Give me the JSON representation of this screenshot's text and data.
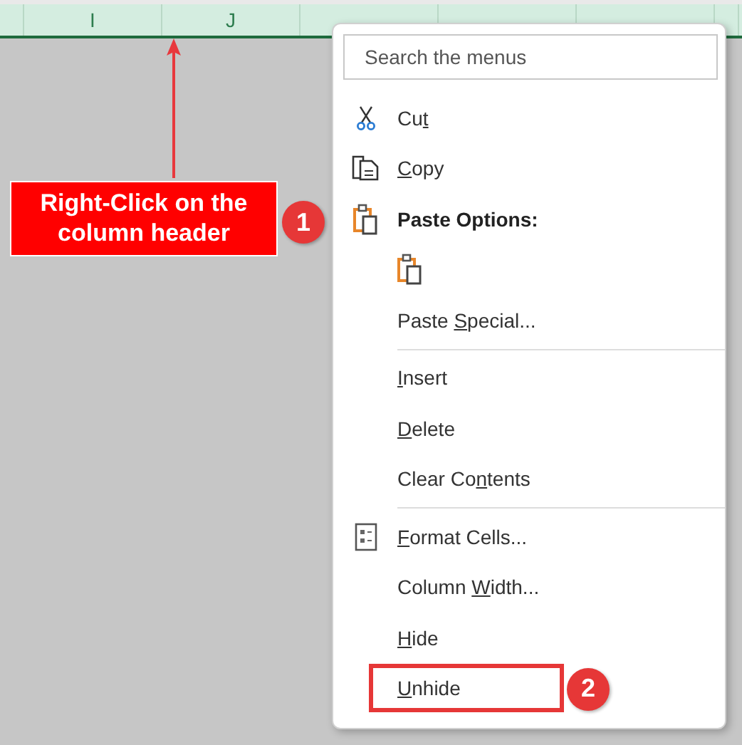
{
  "columns": [
    "I",
    "J"
  ],
  "callout": {
    "text": "Right-Click on the column header",
    "step": "1"
  },
  "menu": {
    "search": {
      "placeholder": "Search the menus"
    },
    "items": [
      {
        "kind": "command",
        "pre": "Cu",
        "key": "t"
      },
      {
        "kind": "command",
        "key": "C",
        "post": "opy"
      },
      {
        "kind": "heading",
        "pre": "Paste Options:"
      },
      {
        "kind": "paste-button"
      },
      {
        "kind": "command",
        "pre": "Paste ",
        "key": "S",
        "post": "pecial..."
      },
      {
        "kind": "divider"
      },
      {
        "kind": "command",
        "key": "I",
        "post": "nsert"
      },
      {
        "kind": "command",
        "key": "D",
        "post": "elete"
      },
      {
        "kind": "command",
        "pre": "Clear Co",
        "key": "n",
        "post": "tents"
      },
      {
        "kind": "divider"
      },
      {
        "kind": "command",
        "key": "F",
        "post": "ormat Cells..."
      },
      {
        "kind": "command",
        "pre": "Column ",
        "key": "W",
        "post": "idth..."
      },
      {
        "kind": "command",
        "key": "H",
        "post": "ide"
      },
      {
        "kind": "command",
        "key": "U",
        "post": "nhide",
        "highlighted": true,
        "step": "2"
      }
    ]
  }
}
